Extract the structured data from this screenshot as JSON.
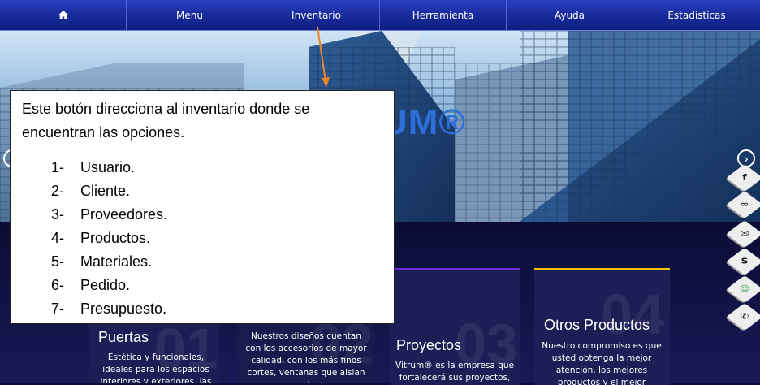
{
  "nav": {
    "home_icon": "home-icon",
    "items": [
      {
        "label": "Menu"
      },
      {
        "label": "Inventario"
      },
      {
        "label": "Herramienta"
      },
      {
        "label": "Ayuda"
      },
      {
        "label": "Estadísticas"
      }
    ]
  },
  "hero": {
    "brand_text": "UM®",
    "prev_label": "‹",
    "next_label": "›"
  },
  "cards": [
    {
      "number": "01",
      "title": "Puertas",
      "desc": "Estética y funcionales, ideales para los espacios interiores y exteriores, las puertas de"
    },
    {
      "number": "02",
      "title": "",
      "desc": "Nuestros diseños cuentan con los accesorios de mayor calidad, con los más finos cortes, ventanas que aislan al"
    },
    {
      "number": "03",
      "title": "Proyectos",
      "desc": "Vitrum® es la empresa que fortalecerá sus proyectos,"
    },
    {
      "number": "04",
      "title": "Otros Productos",
      "desc": "Nuestro compromiso es que usted obtenga la mejor atención, los mejores productos y el mejor servicio"
    }
  ],
  "social": [
    {
      "icon": "facebook-icon",
      "glyph": "f"
    },
    {
      "icon": "link-icon",
      "glyph": "∞"
    },
    {
      "icon": "email-icon",
      "glyph": "✉"
    },
    {
      "icon": "skype-icon",
      "glyph": "S"
    },
    {
      "icon": "chat-icon",
      "glyph": "☺"
    },
    {
      "icon": "phone-icon",
      "glyph": "✆"
    }
  ],
  "annotation": {
    "intro": "Este botón direcciona al inventario donde se encuentran las opciones.",
    "items": [
      {
        "num": "1-",
        "label": "Usuario."
      },
      {
        "num": "2-",
        "label": "Cliente."
      },
      {
        "num": "3-",
        "label": "Proveedores."
      },
      {
        "num": "4-",
        "label": "Productos."
      },
      {
        "num": "5-",
        "label": "Materiales."
      },
      {
        "num": "6-",
        "label": "Pedido."
      },
      {
        "num": "7-",
        "label": "Presupuesto."
      }
    ]
  },
  "colors": {
    "nav": "#172a9a",
    "page_bg": "#0d0f3a",
    "card": "#1c1f55",
    "accent_purple": "#6b2bd6",
    "accent_yellow": "#f2c200",
    "pointer": "#e8862a"
  }
}
